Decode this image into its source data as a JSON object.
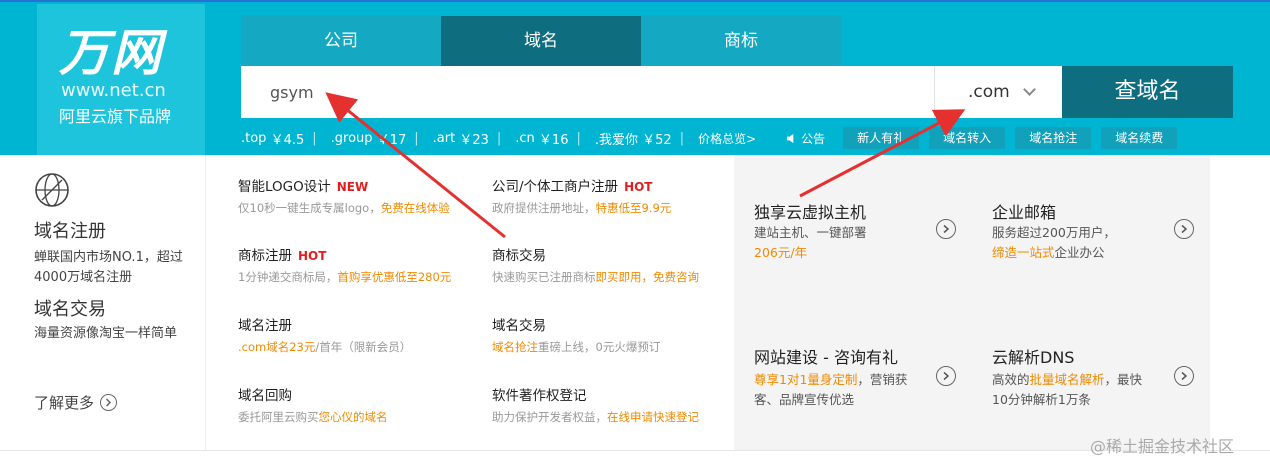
{
  "header": {
    "logo": {
      "main": "万网",
      "url": "www.net.cn",
      "slogan": "阿里云旗下品牌"
    },
    "tabs": [
      {
        "label": "公司",
        "active": false
      },
      {
        "label": "域名",
        "active": true
      },
      {
        "label": "商标",
        "active": false
      }
    ],
    "search": {
      "value": "gsym",
      "suffix": ".com",
      "button": "查域名"
    },
    "prices": [
      {
        "suffix": ".top",
        "price": "￥4.5"
      },
      {
        "suffix": ".group",
        "price": "￥17"
      },
      {
        "suffix": ".art",
        "price": "￥23"
      },
      {
        "suffix": ".cn",
        "price": "￥16"
      },
      {
        "suffix": ".我爱你",
        "price": "￥52"
      }
    ],
    "price_overview": "价格总览>",
    "notice": "公告",
    "quick_buttons": [
      "新人有礼",
      "域名转入",
      "域名抢注",
      "域名续费"
    ],
    "colors": {
      "primary": "#00b5d2",
      "dark": "#0e6d7f",
      "highlight": "#f08a00",
      "hot": "#e02020"
    }
  },
  "left_panel": {
    "icon": "globe-icon",
    "title1": "域名注册",
    "desc1": "蝉联国内市场NO.1，超过4000万域名注册",
    "title2": "域名交易",
    "desc2": "海量资源像淘宝一样简单",
    "more": "了解更多"
  },
  "services": [
    {
      "title": "智能LOGO设计",
      "tag": "NEW",
      "desc": "仅10秒一键生成专属logo，",
      "hl": "免费在线体验",
      "tail": ""
    },
    {
      "title": "公司/个体工商户注册",
      "tag": "HOT",
      "desc": "政府提供注册地址，",
      "hl": "特惠低至9.9元",
      "tail": ""
    },
    {
      "title": "商标注册",
      "tag": "HOT",
      "desc": "1分钟递交商标局，",
      "hl": "首购享优惠低至280元",
      "tail": ""
    },
    {
      "title": "商标交易",
      "tag": "",
      "desc": "快速购买已注册商标",
      "hl": "即买即用，免费咨询",
      "tail": ""
    },
    {
      "title": "域名注册",
      "tag": "",
      "desc": "",
      "hl": ".com域名23元",
      "tail": "/首年（限新会员）"
    },
    {
      "title": "域名交易",
      "tag": "",
      "desc": "",
      "hl": "域名抢注",
      "tail": "重磅上线，0元火爆预订"
    },
    {
      "title": "域名回购",
      "tag": "",
      "desc": "委托阿里云购买",
      "hl": "您心仪的域名",
      "tail": ""
    },
    {
      "title": "软件著作权登记",
      "tag": "",
      "desc": "助力保护开发者权益，",
      "hl": "在线申请快速登记",
      "tail": ""
    }
  ],
  "cards": [
    {
      "title": "独享云虚拟主机",
      "line1": "建站主机、一键部署",
      "hl": "206元/年",
      "tail": ""
    },
    {
      "title": "企业邮箱",
      "line1": "服务超过200万用户，",
      "hl": "缔造一站式",
      "tail": "企业办公"
    },
    {
      "title": "网站建设 - 咨询有礼",
      "line1": "",
      "hl": "尊享1对1量身定制",
      "tail": "，营销获客、品牌宣传优选"
    },
    {
      "title": "云解析DNS",
      "line1": "高效的",
      "hl": "批量域名解析",
      "tail": "，最快 10分钟解析1万条"
    }
  ],
  "watermark": "@稀土掘金技术社区"
}
